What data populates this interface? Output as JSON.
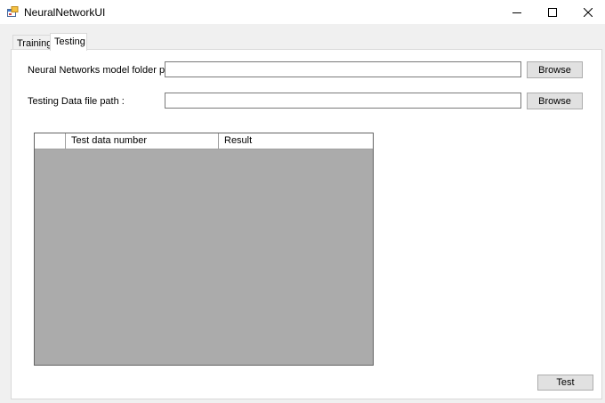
{
  "window": {
    "title": "NeuralNetworkUI",
    "icon": "app-icon",
    "controls": [
      "minimize-icon",
      "maximize-icon",
      "close-icon"
    ]
  },
  "tabs": [
    {
      "label": "Training",
      "active": false
    },
    {
      "label": "Testing",
      "active": true
    }
  ],
  "form": {
    "model_path_label": "Neural Networks model folder path :",
    "model_path_value": "",
    "test_data_label": "Testing Data file path :",
    "test_data_value": "",
    "browse_label": "Browse"
  },
  "grid": {
    "columns": [
      "",
      "Test data number",
      "Result"
    ],
    "rows": []
  },
  "test_button_label": "Test",
  "colors": {
    "grid_background": "#ababab",
    "client_background": "#f0f0f0",
    "button_face": "#e1e1e1"
  }
}
